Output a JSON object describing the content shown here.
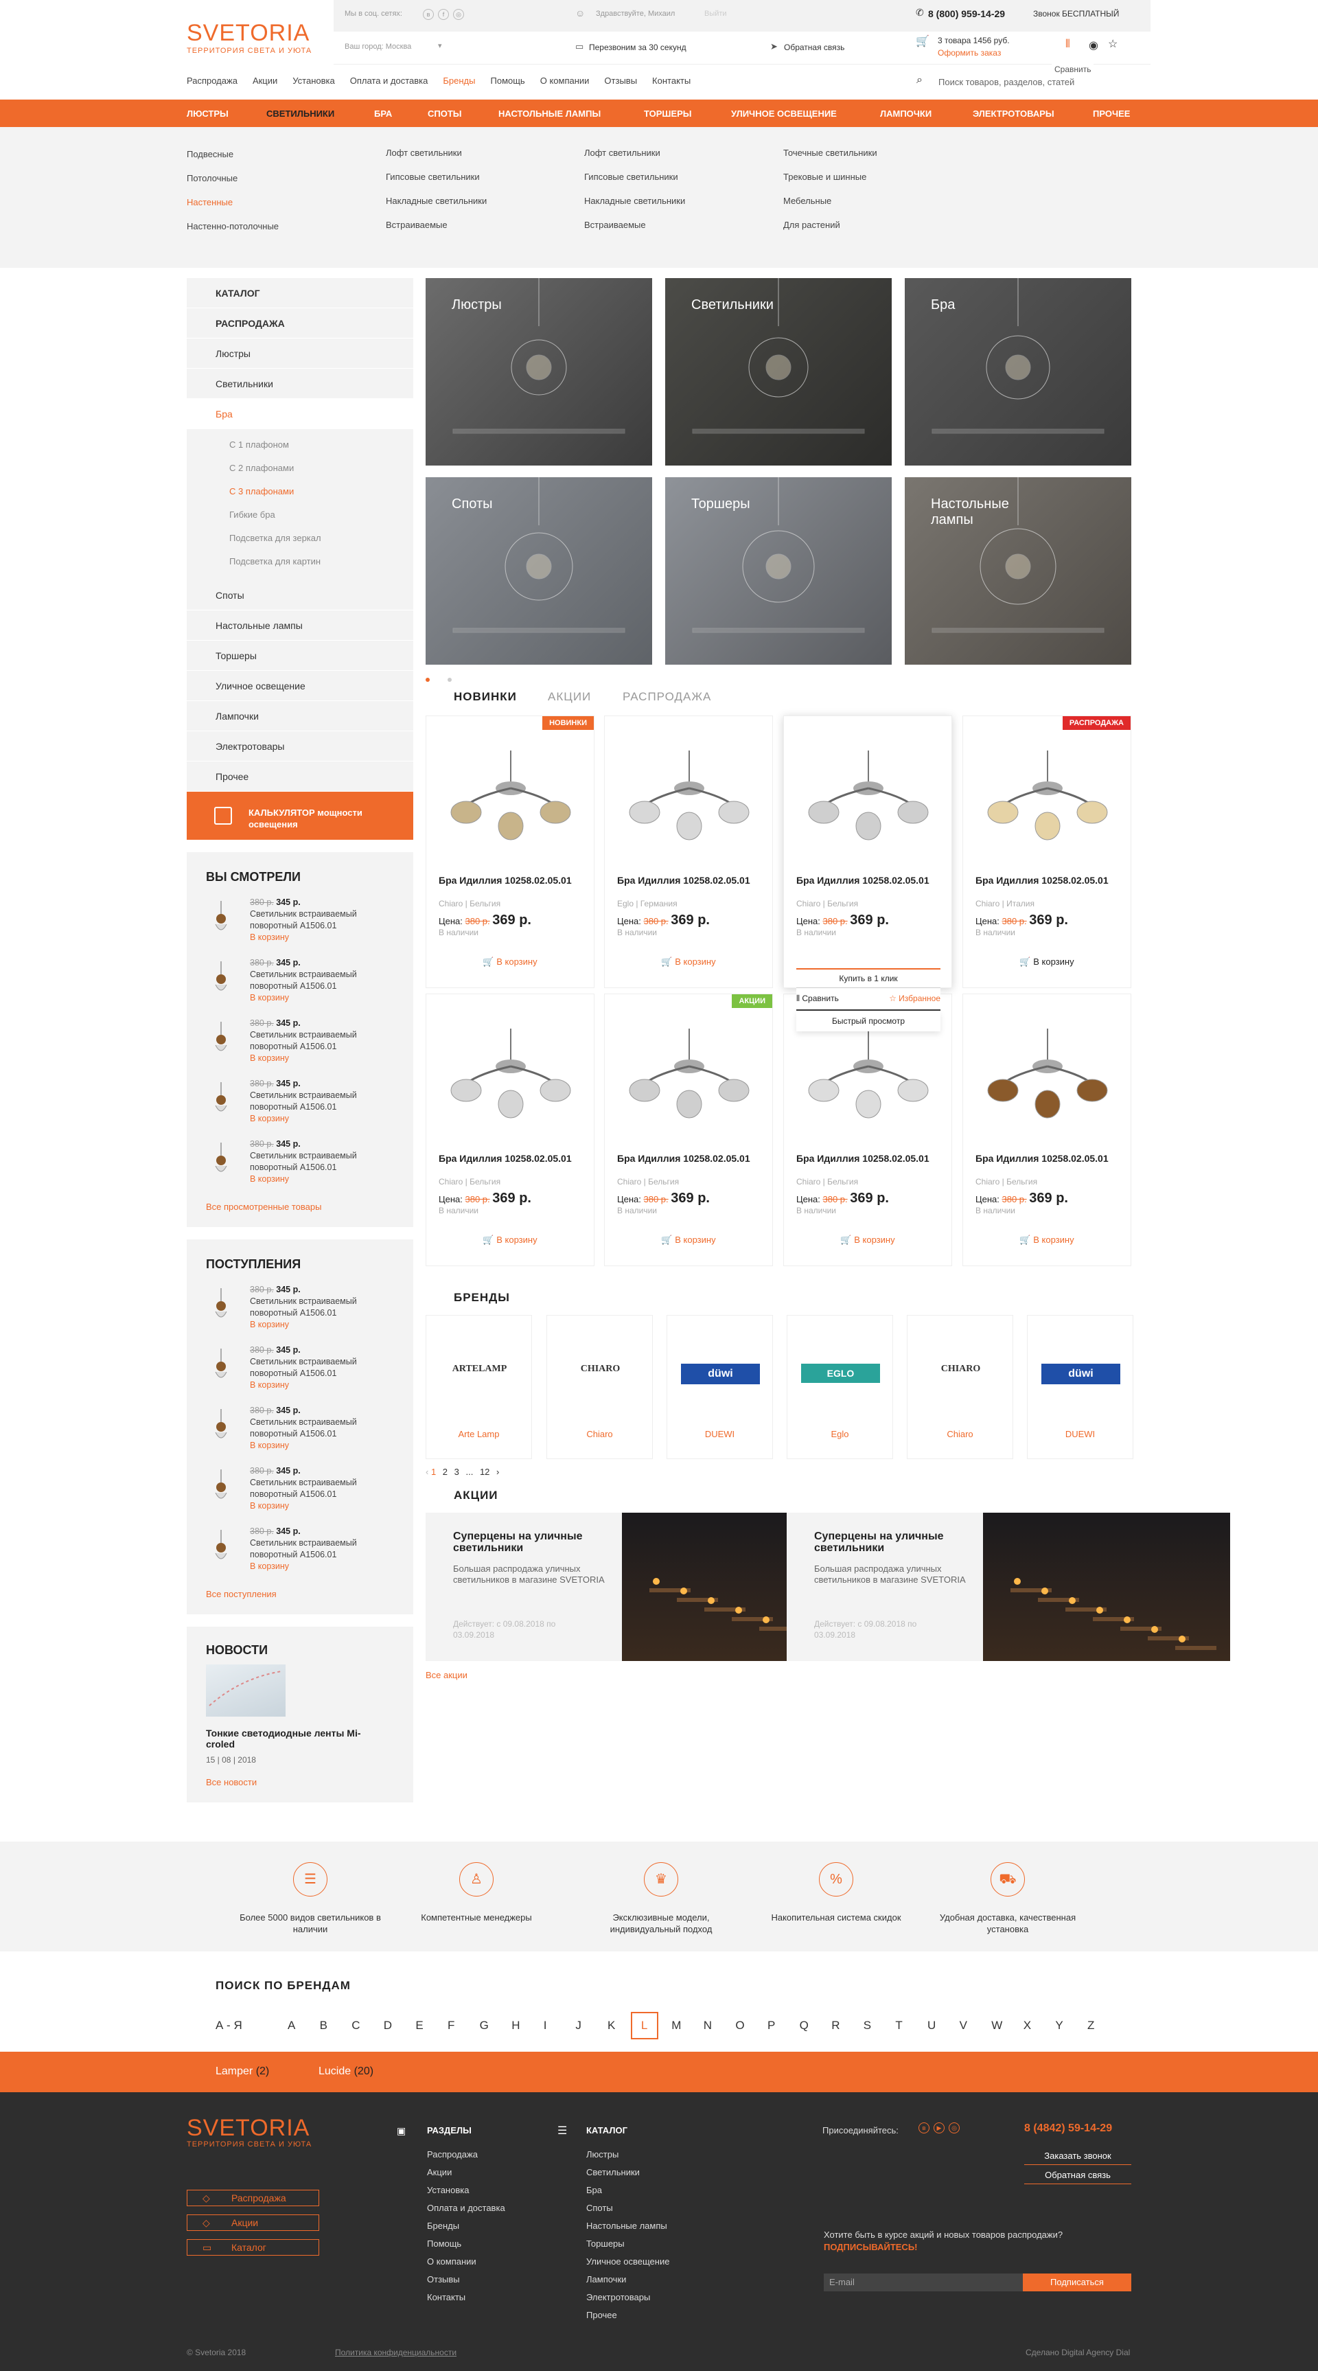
{
  "brand": {
    "name": "SVETORIA",
    "tagline": "ТЕРРИТОРИЯ СВЕТА И УЮТА"
  },
  "topbar": {
    "social_label": "Мы в соц. сетях:",
    "greeting": "Здравствуйте, Михаил",
    "logout": "Выйти",
    "phone": "8 (800) 959-14-29",
    "phone_note": "Звонок БЕСПЛАТНЫЙ",
    "city": "Ваш город: Москва",
    "callback30": "Перезвоним за 30 секунд",
    "feedback": "Обратная связь",
    "cart_summary": "3 товара 1456 руб.",
    "checkout": "Оформить заказ",
    "compare_tooltip": "Сравнить"
  },
  "mainnav": [
    "Распродажа",
    "Акции",
    "Установка",
    "Оплата и доставка",
    "Бренды",
    "Помощь",
    "О компании",
    "Отзывы",
    "Контакты"
  ],
  "search": {
    "placeholder": "Поиск товаров, разделов, статей"
  },
  "catnav": [
    "ЛЮСТРЫ",
    "СВЕТИЛЬНИКИ",
    "БРА",
    "СПОТЫ",
    "НАСТОЛЬНЫЕ ЛАМПЫ",
    "ТОРШЕРЫ",
    "УЛИЧНОЕ ОСВЕЩЕНИЕ",
    "ЛАМПОЧКИ",
    "ЭЛЕКТРОТОВАРЫ",
    "ПРОЧЕЕ"
  ],
  "mega": [
    [
      "Подвесные",
      "Потолочные",
      "Настенные",
      "Настенно-потолочные"
    ],
    [
      "Лофт светильники",
      "Гипсовые светильники",
      "Накладные светильники",
      "Встраиваемые"
    ],
    [
      "Лофт светильники",
      "Гипсовые светильники",
      "Накладные светильники",
      "Встраиваемые"
    ],
    [
      "Точечные светильники",
      "Трековые и шинные",
      "Мебельные",
      "Для растений"
    ]
  ],
  "sidebar": {
    "catalog": "КАТАЛОГ",
    "sale": "РАСПРОДАЖА",
    "items_top": [
      "Люстры",
      "Светильники",
      "Бра"
    ],
    "sub": [
      "С 1 плафоном",
      "С 2 плафонами",
      "С 3 плафонами",
      "Гибкие бра",
      "Подсветка для зеркал",
      "Подсветка для картин"
    ],
    "items_bottom": [
      "Споты",
      "Настольные лампы",
      "Торшеры",
      "Уличное освещение",
      "Лампочки",
      "Электротовары",
      "Прочее"
    ],
    "calc": "КАЛЬКУЛЯТОР мощности освещения"
  },
  "viewed": {
    "title": "ВЫ СМОТРЕЛИ",
    "old": "380 р.",
    "new": "345 р.",
    "name": "Светильник встраиваемый поворотный A1506.01",
    "cart": "В корзину",
    "more": "Все просмотренные товары"
  },
  "arrivals": {
    "title": "ПОСТУПЛЕНИЯ",
    "more": "Все поступления"
  },
  "news": {
    "title": "НОВОСТИ",
    "headline": "Тонкие светодиодные ленты Mi-croled",
    "date": "15 | 08 | 2018",
    "more": "Все новости"
  },
  "tiles": [
    "Люстры",
    "Светильники",
    "Бра",
    "Споты",
    "Торшеры",
    "Настольные лампы"
  ],
  "tabs": [
    "НОВИНКИ",
    "АКЦИИ",
    "РАСПРОДАЖА"
  ],
  "product": {
    "name": "Бра Идиллия 10258.02.05.01",
    "price_label": "Цена:",
    "old": "380 р.",
    "new": "369 р.",
    "avail": "В наличии",
    "cart": "В корзину"
  },
  "product_brands": [
    [
      "Chiaro",
      "Бельгия"
    ],
    [
      "Eglo",
      "Германия"
    ],
    [
      "Chiaro",
      "Бельгия"
    ],
    [
      "Chiaro",
      "Италия"
    ],
    [
      "Chiaro",
      "Бельгия"
    ],
    [
      "Chiaro",
      "Бельгия"
    ],
    [
      "Chiaro",
      "Бельгия"
    ],
    [
      "Chiaro",
      "Бельгия"
    ]
  ],
  "badges": {
    "new": "НОВИНКИ",
    "sale": "РАСПРОДАЖА",
    "promo": "АКЦИИ"
  },
  "hover_menu": {
    "one_click": "Купить в 1 клик",
    "compare": "Сравнить",
    "fav": "Избранное",
    "quick": "Быстрый просмотр"
  },
  "brands": {
    "title": "БРЕНДЫ",
    "items": [
      "Arte Lamp",
      "Chiaro",
      "DUEWI",
      "Eglo",
      "Chiaro",
      "DUEWI"
    ],
    "logos": [
      "ARTELAMP",
      "CHIARO",
      "düwi",
      "EGLO",
      "CHIARO",
      "düwi"
    ]
  },
  "pagination": [
    "1",
    "2",
    "3",
    "...",
    "12"
  ],
  "promos": {
    "title": "АКЦИИ",
    "item_title": "Суперцены на уличные светильники",
    "item_desc": "Большая распродажа уличных светильников в магазине SVETORIA",
    "item_valid": "Действует: с 09.08.2018 по 03.09.2018",
    "more": "Все акции"
  },
  "features": [
    "Более 5000 видов светильников в наличии",
    "Компетентные менеджеры",
    "Эксклюзивные модели, индивидуальный подход",
    "Накопительная система скидок",
    "Удобная доставка, качественная установка"
  ],
  "brand_search": {
    "title": "ПОИСК ПО БРЕНДАМ",
    "az": "А - Я",
    "letters": [
      "A",
      "B",
      "C",
      "D",
      "E",
      "F",
      "G",
      "H",
      "I",
      "J",
      "K",
      "L",
      "M",
      "N",
      "O",
      "P",
      "Q",
      "R",
      "S",
      "T",
      "U",
      "V",
      "W",
      "X",
      "Y",
      "Z"
    ],
    "active": "L"
  },
  "brand_results": [
    {
      "name": "Lamper",
      "count": "(2)"
    },
    {
      "name": "Lucide",
      "count": "(20)"
    }
  ],
  "footer": {
    "buttons": [
      "Распродажа",
      "Акции",
      "Каталог"
    ],
    "sections_title": "РАЗДЕЛЫ",
    "sections": [
      "Распродажа",
      "Акции",
      "Установка",
      "Оплата и доставка",
      "Бренды",
      "Помощь",
      "О компании",
      "Отзывы",
      "Контакты"
    ],
    "catalog_title": "КАТАЛОГ",
    "catalog": [
      "Люстры",
      "Светильники",
      "Бра",
      "Споты",
      "Настольные лампы",
      "Торшеры",
      "Уличное освещение",
      "Лампочки",
      "Электротовары",
      "Прочее"
    ],
    "join": "Присоединяйтесь:",
    "phone": "8 (4842) 59-14-29",
    "order_call": "Заказать звонок",
    "feedback": "Обратная связь",
    "subscribe_q": "Хотите быть в курсе акций и новых товаров распродажи?",
    "subscribe_cta": "ПОДПИСЫВАЙТЕСЬ!",
    "email_placeholder": "E-mail",
    "subscribe_btn": "Подписаться",
    "copyright": "© Svetoria 2018",
    "privacy": "Политика конфиденциальности",
    "made_by": "Сделано Digital Agency Dial"
  },
  "colors": {
    "accent": "#ef6a2b",
    "footer": "#2e2e2e",
    "panel": "#f3f3f3"
  }
}
